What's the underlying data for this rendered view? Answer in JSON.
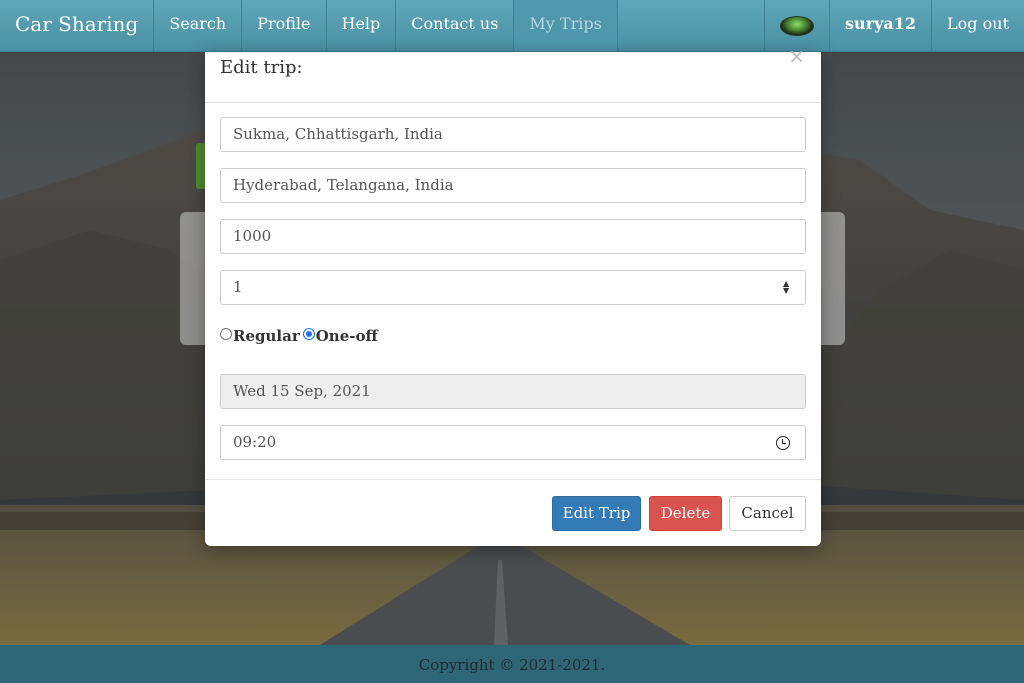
{
  "navbar": {
    "brand": "Car Sharing",
    "items": [
      {
        "label": "Search"
      },
      {
        "label": "Profile"
      },
      {
        "label": "Help"
      },
      {
        "label": "Contact us"
      },
      {
        "label": "My Trips",
        "active": true
      }
    ],
    "username": "surya12",
    "logout": "Log out"
  },
  "modal": {
    "title": "Edit trip:",
    "close": "×",
    "departure": "Sukma, Chhattisgarh, India",
    "destination": "Hyderabad, Telangana, India",
    "price": "1000",
    "seats": "1",
    "frequency": {
      "options": [
        "Regular",
        "One-off"
      ],
      "selected": "One-off"
    },
    "date": "Wed 15 Sep, 2021",
    "time": "09:20",
    "buttons": {
      "edit": "Edit Trip",
      "delete": "Delete",
      "cancel": "Cancel"
    }
  },
  "footer": {
    "copyright": "Copyright © 2021-2021."
  },
  "colors": {
    "navbar": "#5fa6b8",
    "primary": "#337ab7",
    "danger": "#d9534f",
    "footer": "#2e6577"
  }
}
